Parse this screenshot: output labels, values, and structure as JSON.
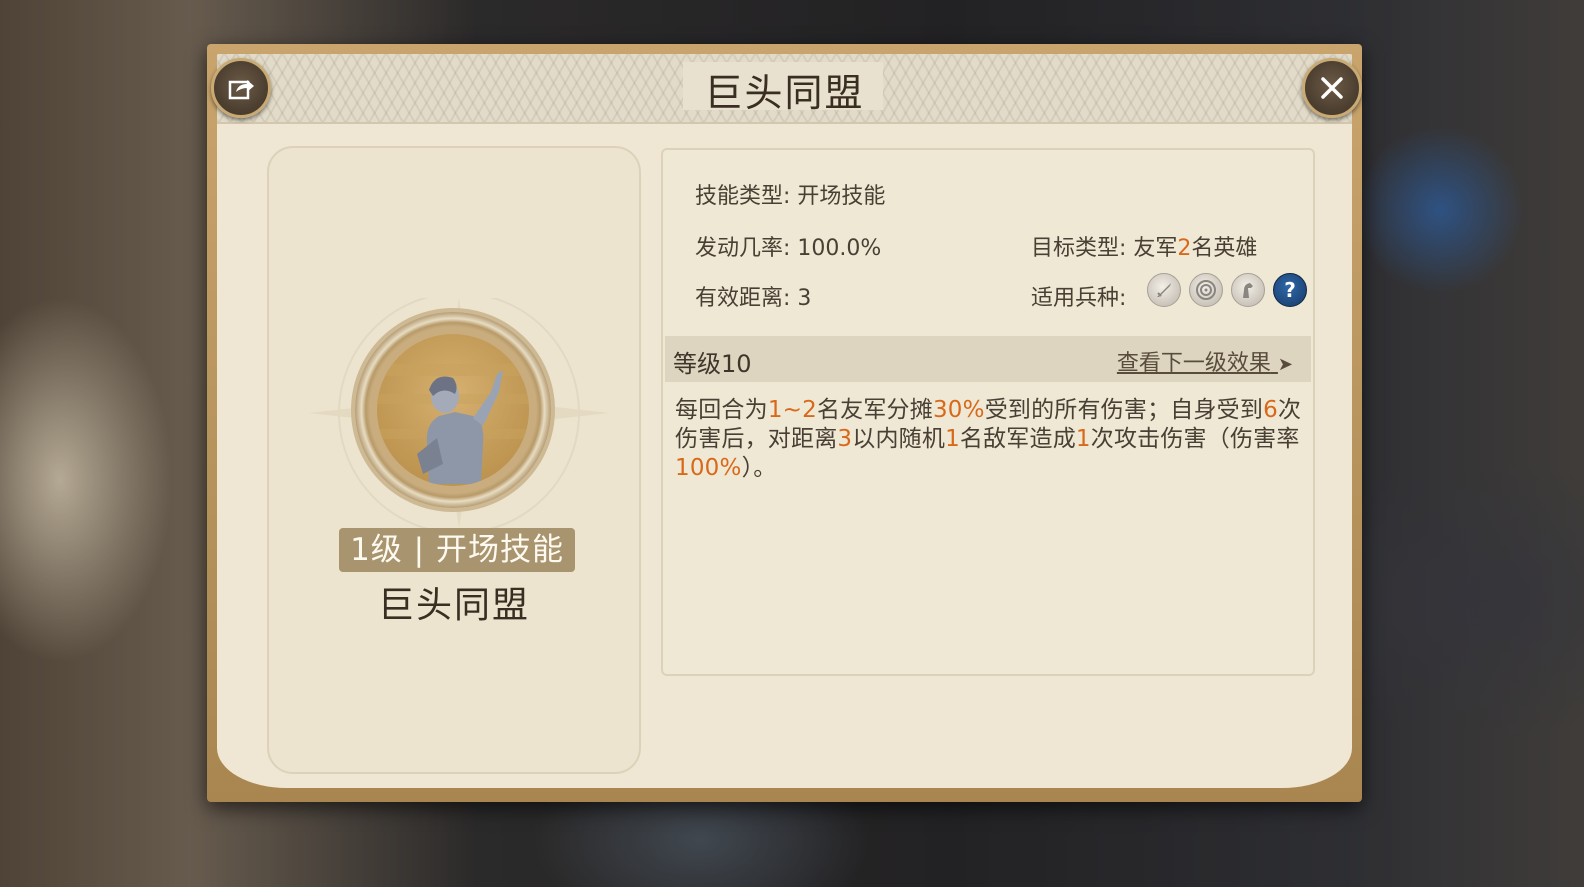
{
  "dialog": {
    "title": "巨头同盟"
  },
  "left_card": {
    "level_badge": "1级 | 开场技能",
    "skill_name": "巨头同盟"
  },
  "info": {
    "skill_type": "技能类型: 开场技能",
    "trigger_rate": "发动几率: 100.0%",
    "target_prefix": "目标类型: 友军",
    "target_number": "2",
    "target_suffix": "名英雄",
    "range": "有效距离: 3",
    "troop_label": "适用兵种:",
    "troop_icons": [
      "sword-icon",
      "target-icon",
      "horse-icon",
      "question-icon"
    ],
    "help_symbol": "?"
  },
  "level_bar": {
    "level": "等级10",
    "next_link": "查看下一级效果",
    "arrow": "➤"
  },
  "description": {
    "segments": [
      {
        "t": "每回合为",
        "hl": false
      },
      {
        "t": "1~2",
        "hl": true
      },
      {
        "t": "名友军分摊",
        "hl": false
      },
      {
        "t": "30%",
        "hl": true
      },
      {
        "t": "受到的所有伤害；自身受到",
        "hl": false
      },
      {
        "t": "6",
        "hl": true
      },
      {
        "t": "次伤害后，对距离",
        "hl": false
      },
      {
        "t": "3",
        "hl": true
      },
      {
        "t": "以内随机",
        "hl": false
      },
      {
        "t": "1",
        "hl": true
      },
      {
        "t": "名敌军造成",
        "hl": false
      },
      {
        "t": "1",
        "hl": true
      },
      {
        "t": "次攻击伤害（伤害率",
        "hl": false
      },
      {
        "t": "100%",
        "hl": true
      },
      {
        "t": "）。",
        "hl": false
      }
    ]
  },
  "colors": {
    "highlight": "#d9691a",
    "frame": "#c9a46c",
    "parchment": "#efe7d3"
  }
}
